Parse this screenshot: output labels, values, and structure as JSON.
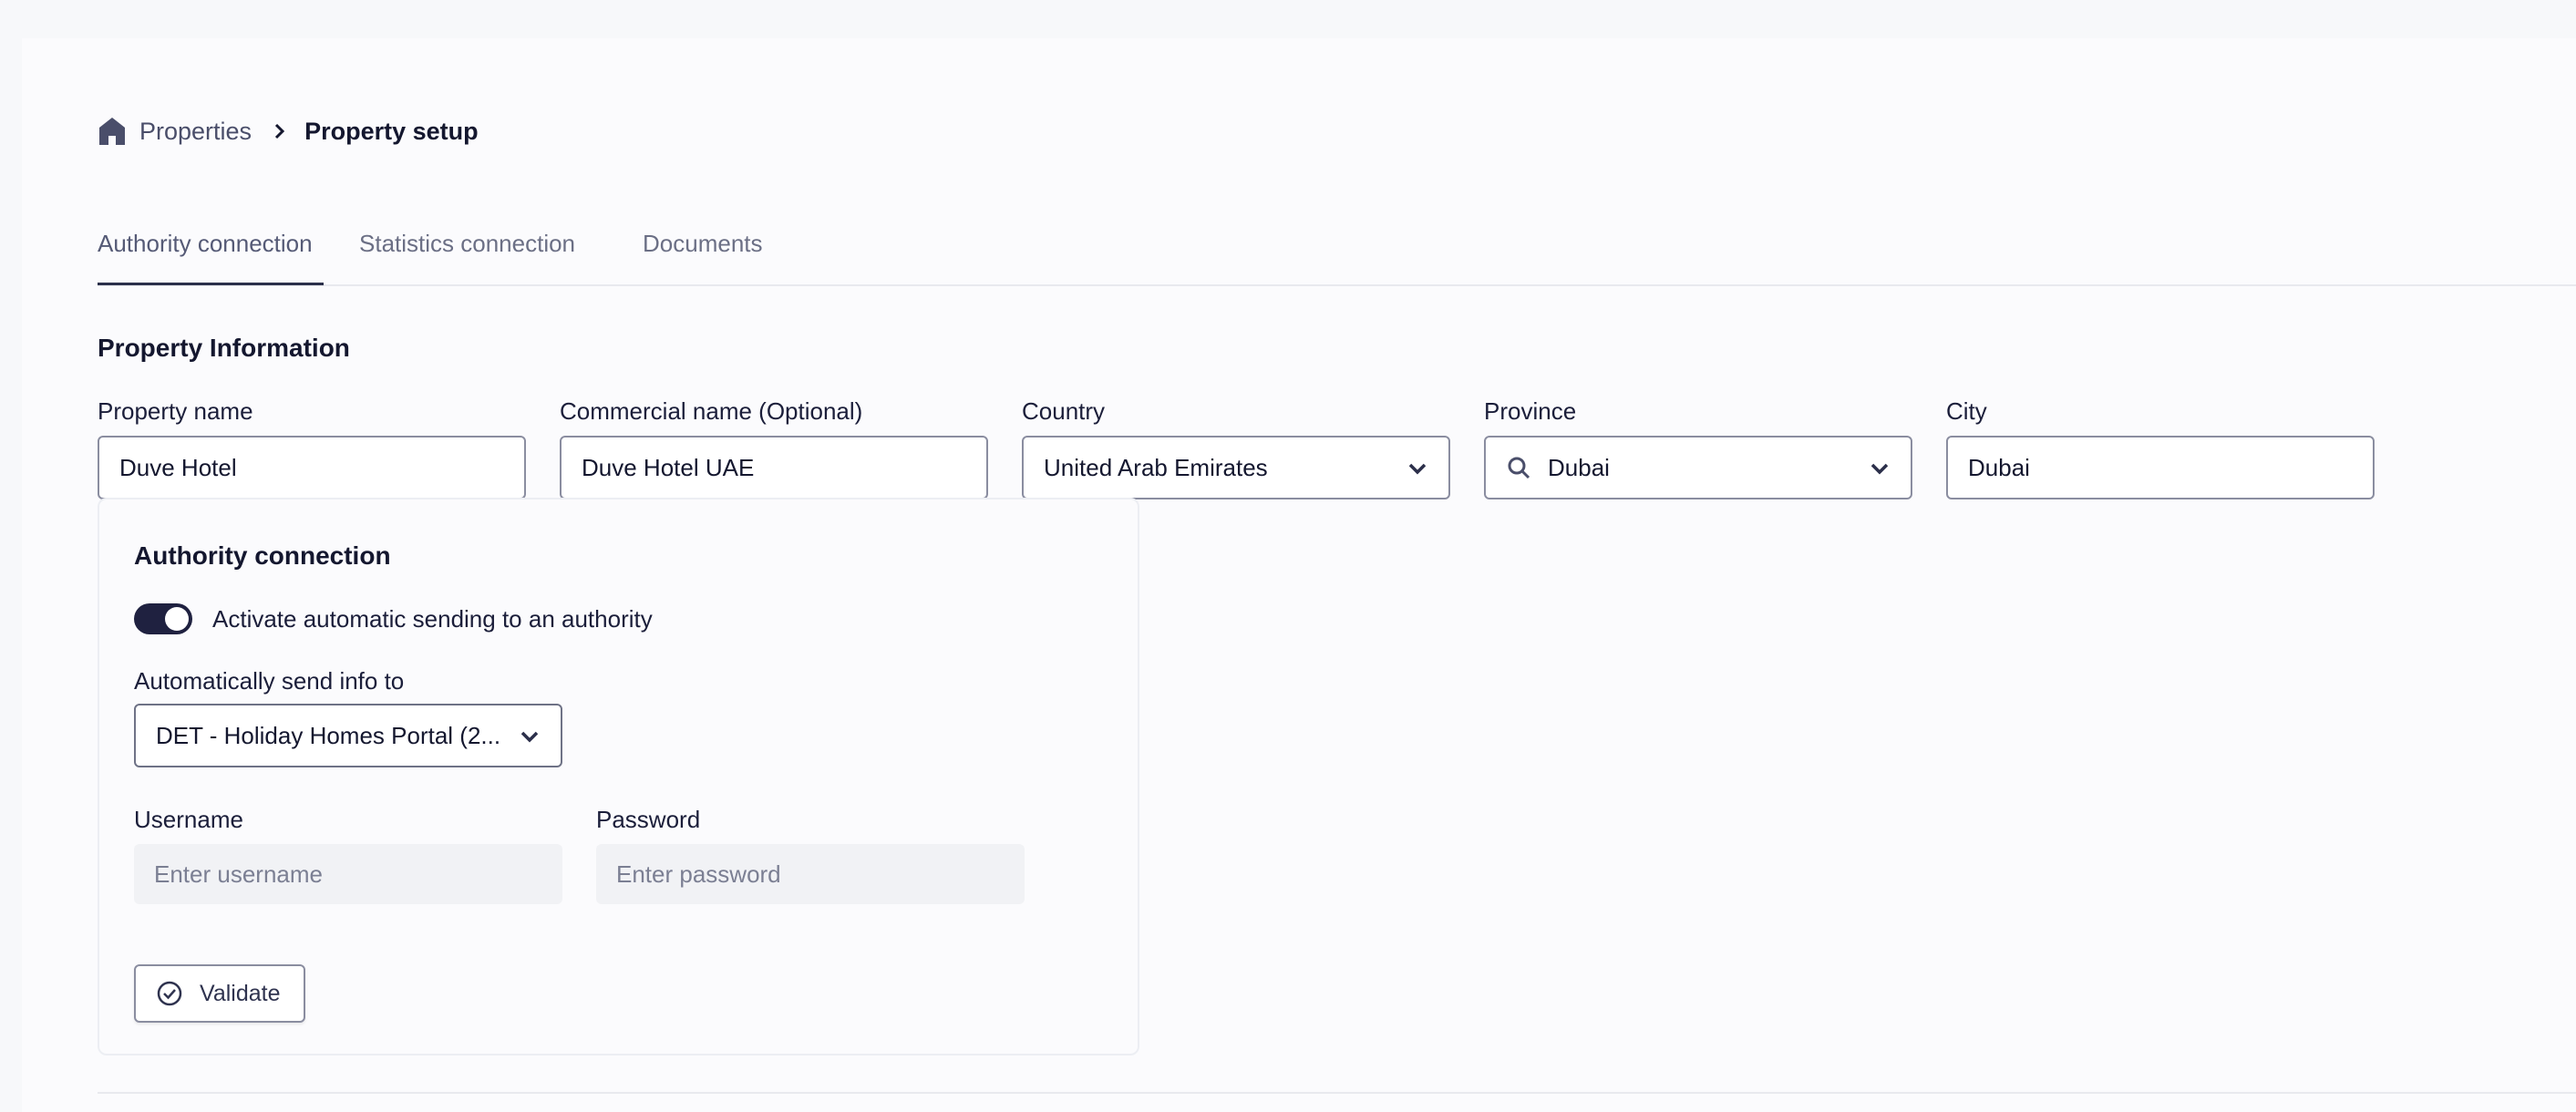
{
  "breadcrumb": {
    "root": "Properties",
    "current": "Property setup"
  },
  "tabs": [
    {
      "label": "Authority connection",
      "active": true
    },
    {
      "label": "Statistics connection",
      "active": false
    },
    {
      "label": "Documents",
      "active": false
    }
  ],
  "property_info": {
    "title": "Property Information",
    "fields": {
      "property_name": {
        "label": "Property name",
        "value": "Duve Hotel"
      },
      "commercial_name": {
        "label": "Commercial name (Optional)",
        "value": "Duve Hotel UAE"
      },
      "country": {
        "label": "Country",
        "value": "United Arab Emirates"
      },
      "province": {
        "label": "Province",
        "value": "Dubai"
      },
      "city": {
        "label": "City",
        "value": "Dubai"
      }
    }
  },
  "authority": {
    "title": "Authority connection",
    "toggle_label": "Activate automatic sending to an authority",
    "toggle_on": true,
    "send_to_label": "Automatically send info to",
    "send_to_value": "DET - Holiday Homes Portal (2...",
    "username_label": "Username",
    "username_placeholder": "Enter username",
    "password_label": "Password",
    "password_placeholder": "Enter password",
    "validate_label": "Validate"
  },
  "colors": {
    "accent": "#1f2140",
    "border": "#8a8da0",
    "page": "#fbfbfd"
  }
}
